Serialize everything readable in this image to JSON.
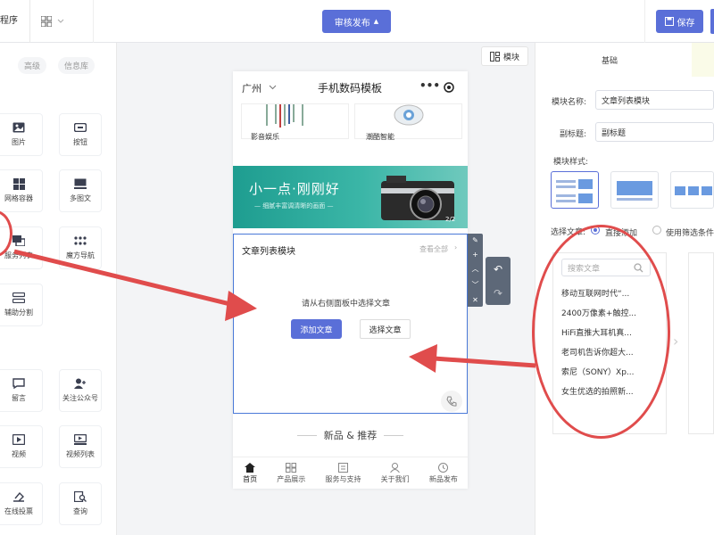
{
  "topbar": {
    "left_label": "程序",
    "publish_label": "审核发布",
    "save_label": "保存"
  },
  "left_panel": {
    "tabs": [
      "高级",
      "信息库"
    ],
    "components": [
      {
        "label": "图片",
        "icon": "image-icon"
      },
      {
        "label": "按钮",
        "icon": "button-icon"
      },
      {
        "label": "网格容器",
        "icon": "grid-icon"
      },
      {
        "label": "多图文",
        "icon": "multi-image-text-icon"
      },
      {
        "label": "服务列表",
        "icon": "service-list-icon"
      },
      {
        "label": "魔方导航",
        "icon": "cube-nav-icon"
      },
      {
        "label": "辅助分割",
        "icon": "divider-icon"
      },
      {
        "label": "留言",
        "icon": "comment-icon"
      },
      {
        "label": "关注公众号",
        "icon": "follow-icon"
      },
      {
        "label": "视频",
        "icon": "video-icon"
      },
      {
        "label": "视频列表",
        "icon": "video-list-icon"
      },
      {
        "label": "在线投票",
        "icon": "vote-icon"
      },
      {
        "label": "查询",
        "icon": "search-doc-icon"
      }
    ]
  },
  "canvas": {
    "module_button": "模块",
    "phone": {
      "city": "广州",
      "title": "手机数码模板",
      "cards": [
        "影音娱乐",
        "潮酷智能"
      ],
      "banner_title": "小一点·刚刚好",
      "banner_sub": "— 细腻丰富调清晰的画面 —",
      "banner_mark": "2/2",
      "article_module": {
        "title": "文章列表模块",
        "view_all": "查看全部",
        "hint": "请从右侧面板中选择文章",
        "add_label": "添加文章",
        "select_label": "选择文章"
      },
      "section_title": "新品 & 推荐",
      "footer": [
        "首页",
        "产品展示",
        "服务与支持",
        "关于我们",
        "新品发布"
      ]
    }
  },
  "right_panel": {
    "tab_basic": "基础",
    "module_name_label": "模块名称:",
    "module_name_value": "文章列表模块",
    "subtitle_label": "副标题:",
    "subtitle_value": "副标题",
    "style_label": "模块样式:",
    "select_article_label": "选择文章:",
    "radio_add": "直接添加",
    "radio_filter": "使用筛选条件",
    "search_placeholder": "搜索文章",
    "articles": [
      "移动互联网时代“...",
      "2400万像素+触控...",
      "HiFi直推大耳机真...",
      "老司机告诉你超大...",
      "索尼（SONY）Xp...",
      "女生优选的拍照新..."
    ]
  },
  "colors": {
    "accent": "#5a6fd8",
    "annotation": "#e04c4c",
    "banner": "#2aa99a"
  }
}
